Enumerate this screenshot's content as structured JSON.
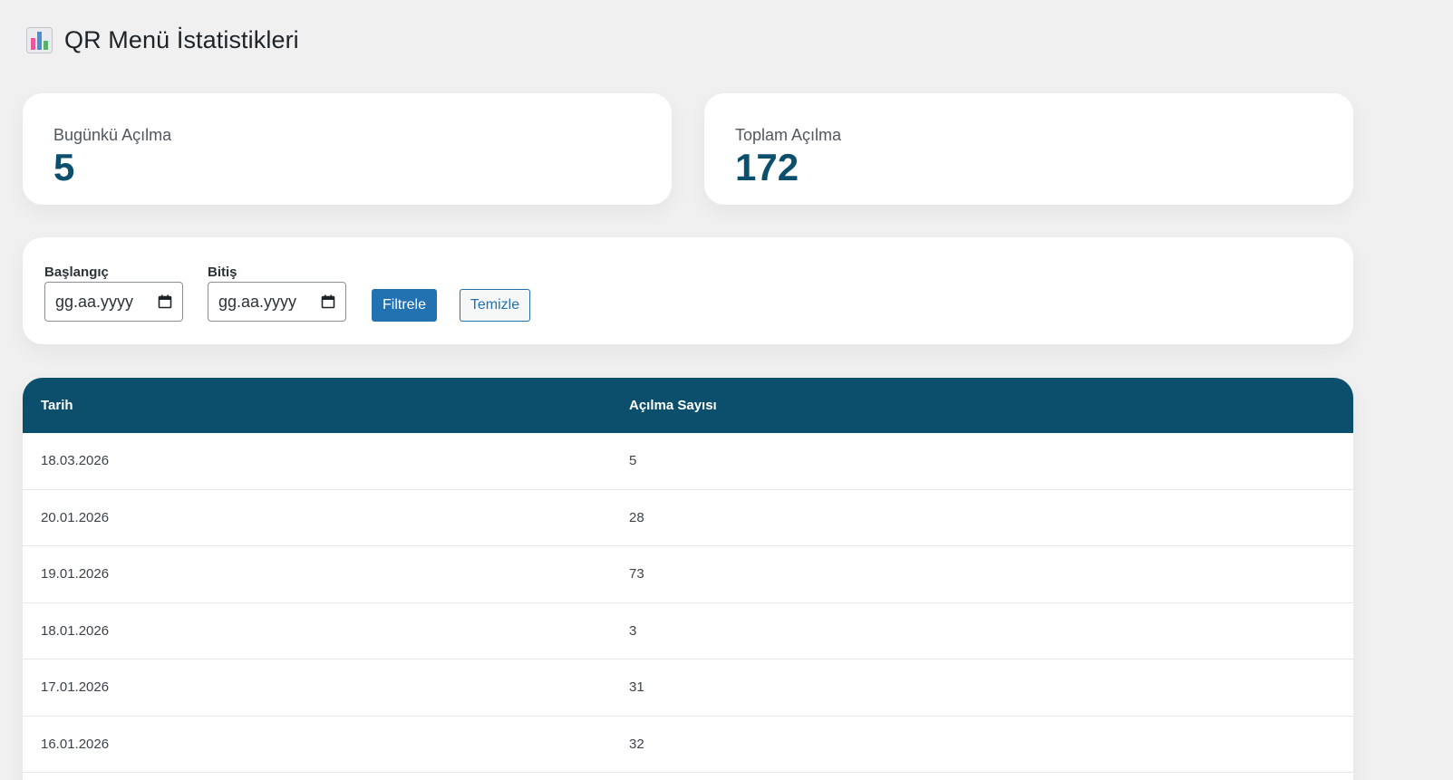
{
  "header": {
    "title": "QR Menü İstatistikleri",
    "icon": "bar-chart-icon"
  },
  "stats": {
    "today": {
      "label": "Bugünkü Açılma",
      "value": "5"
    },
    "total": {
      "label": "Toplam Açılma",
      "value": "172"
    }
  },
  "filter": {
    "start_label": "Başlangıç",
    "start_placeholder": "gg.aa.yyyy",
    "end_label": "Bitiş",
    "end_placeholder": "gg.aa.yyyy",
    "filter_button": "Filtrele",
    "clear_button": "Temizle"
  },
  "table": {
    "columns": [
      "Tarih",
      "Açılma Sayısı"
    ],
    "rows": [
      [
        "18.03.2026",
        "5"
      ],
      [
        "20.01.2026",
        "28"
      ],
      [
        "19.01.2026",
        "73"
      ],
      [
        "18.01.2026",
        "3"
      ],
      [
        "17.01.2026",
        "31"
      ],
      [
        "16.01.2026",
        "32"
      ]
    ]
  },
  "colors": {
    "accent": "#0b4f6c",
    "button": "#2271b1",
    "background": "#f0f0f1"
  }
}
